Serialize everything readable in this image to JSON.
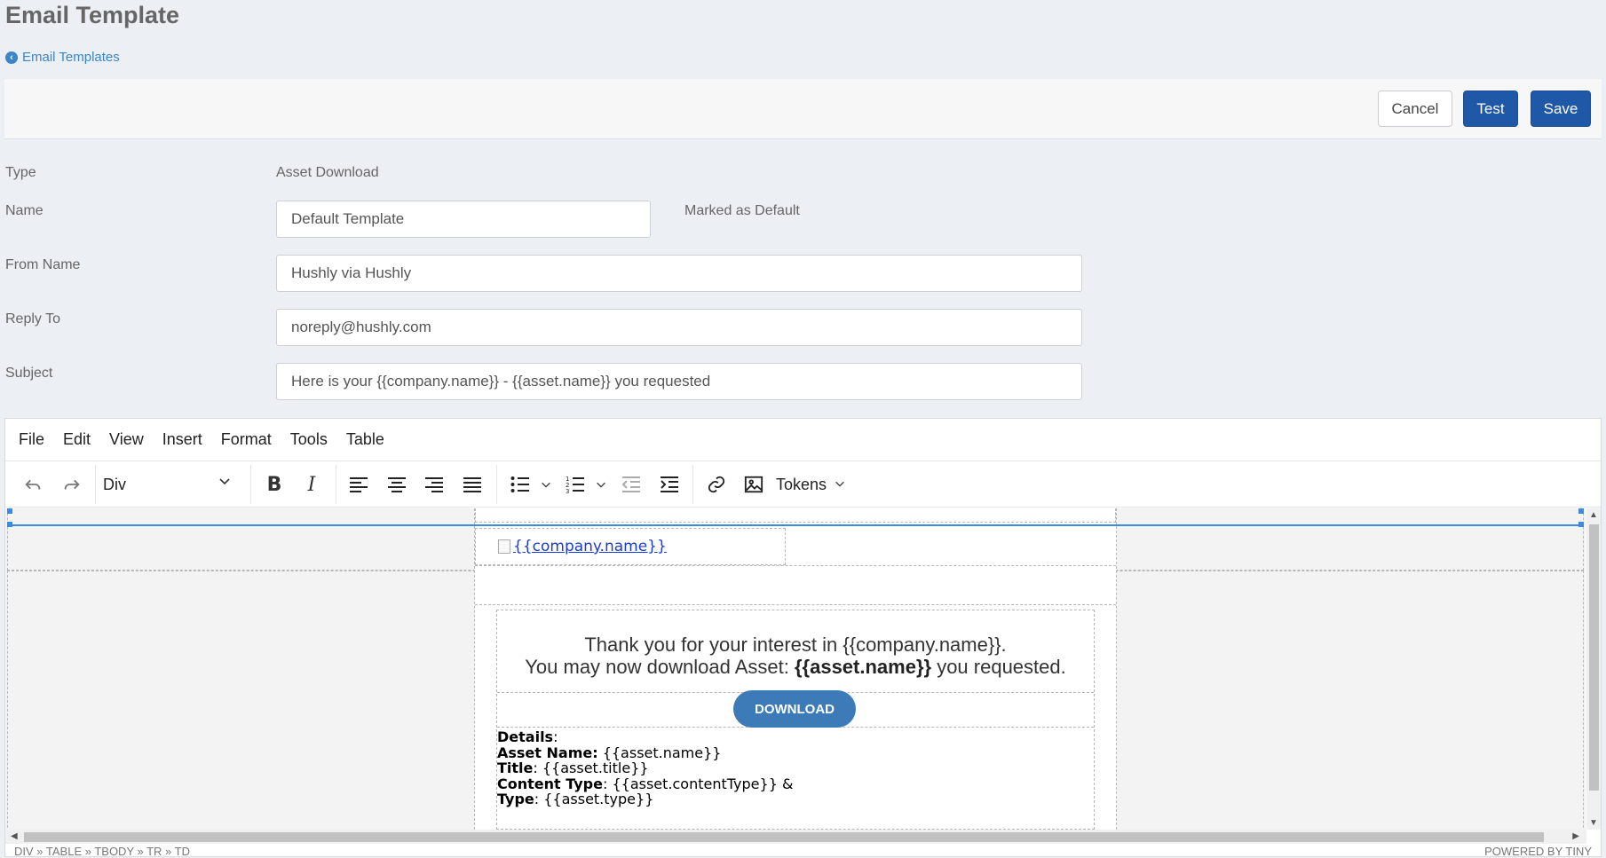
{
  "page": {
    "title": "Email Template",
    "back_link": "Email Templates"
  },
  "actions": {
    "cancel": "Cancel",
    "test": "Test",
    "save": "Save"
  },
  "form": {
    "type_label": "Type",
    "type_value": "Asset Download",
    "name_label": "Name",
    "name_value": "Default Template",
    "marked_default": "Marked as Default",
    "from_name_label": "From Name",
    "from_name_value": "Hushly via Hushly",
    "reply_to_label": "Reply To",
    "reply_to_value": "noreply@hushly.com",
    "subject_label": "Subject",
    "subject_value": "Here is your {{company.name}} - {{asset.name}} you requested"
  },
  "editor": {
    "menu": [
      "File",
      "Edit",
      "View",
      "Insert",
      "Format",
      "Tools",
      "Table"
    ],
    "block_format": "Div",
    "tokens": "Tokens",
    "toolbar_icons": [
      "undo-icon",
      "redo-icon",
      "bold-icon",
      "italic-icon",
      "align-left-icon",
      "align-center-icon",
      "align-right-icon",
      "align-justify-icon",
      "bullet-list-icon",
      "numbered-list-icon",
      "outdent-icon",
      "indent-icon",
      "link-icon",
      "image-icon"
    ],
    "status_path": "DIV » TABLE » TBODY » TR » TD",
    "powered_by": "POWERED BY TINY"
  },
  "email": {
    "logo_alt": "{{company.name}}",
    "thanks_line1": "Thank you for your interest in {{company.name}}.",
    "thanks_line2_prefix": "You may now download Asset: ",
    "thanks_line2_bold": "{{asset.name}}",
    "thanks_line2_suffix": " you requested.",
    "download_button": "DOWNLOAD",
    "details_label": "Details",
    "details_colon": ":",
    "asset_name_label": "Asset Name:",
    "asset_name_value": " {{asset.name}}",
    "title_label": "Title",
    "title_value": ": {{asset.title}}",
    "content_type_label": "Content Type",
    "content_type_value": ": {{asset.contentType}} &",
    "type_label": "Type",
    "type_value": ": {{asset.type}}"
  },
  "colors": {
    "primary_button": "#1f58a6",
    "link": "#3a87c7",
    "download_button": "#3d7bb8",
    "selection": "#3d8bde"
  }
}
